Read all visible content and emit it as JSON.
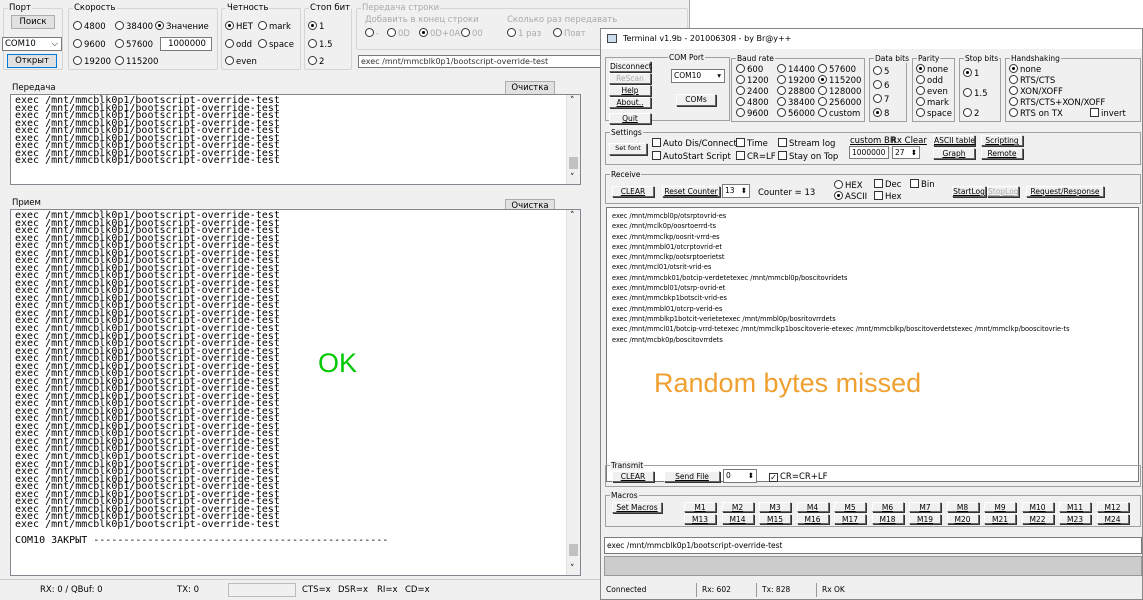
{
  "left": {
    "port": {
      "label": "Порт",
      "search": "Поиск",
      "com": "COM10",
      "open": "Открыт"
    },
    "speed": {
      "label": "Скорость",
      "opts": [
        "4800",
        "9600",
        "19200",
        "38400",
        "57600",
        "115200"
      ],
      "value_label": "Значение",
      "value": "1000000"
    },
    "parity": {
      "label": "Четность",
      "none": "НЕТ",
      "mark": "mark",
      "odd": "odd",
      "space": "space",
      "even": "even"
    },
    "stop": {
      "label": "Стоп бит",
      "o1": "1",
      "o15": "1.5",
      "o2": "2"
    },
    "line_end": {
      "label": "Передача строки",
      "add": "Добавить в конец строки",
      "opts": [
        "-",
        "0D",
        "0D+0A",
        "00"
      ],
      "repeat": "Сколько раз передавать",
      "once": "1 раз",
      "rep": "Повт"
    },
    "cmd": "exec /mnt/mmcblk0p1/bootscript-override-test",
    "tx": {
      "label": "Передача",
      "clear": "Очистка",
      "lines": [
        "exec /mnt/mmcblk0p1/bootscript-override-test",
        "exec /mnt/mmcblk0p1/bootscript-override-test",
        "exec /mnt/mmcblk0p1/bootscript-override-test",
        "exec /mnt/mmcblk0p1/bootscript-override-test",
        "exec /mnt/mmcblk0p1/bootscript-override-test",
        "exec /mnt/mmcblk0p1/bootscript-override-test",
        "exec /mnt/mmcblk0p1/bootscript-override-test",
        "exec /mnt/mmcblk0p1/bootscript-override-test",
        "exec /mnt/mmcblk0p1/bootscript-override-test"
      ]
    },
    "rx": {
      "label": "Прием",
      "clear": "Очистка",
      "line": "exec /mnt/mmcblk0p1/bootscript-override-test",
      "count": 42,
      "closed": "COM10 ЗАКРЫТ -------------------------------------------------"
    },
    "ok": "OK",
    "status": {
      "rx": "RX: 0 / QBuf: 0",
      "tx": "TX: 0",
      "cts": "CTS=x",
      "dsr": "DSR=x",
      "ri": "RI=x",
      "cd": "CD=x"
    }
  },
  "right": {
    "title": "Terminal v1.9b - 20100630Я - by Br@y++",
    "btns": {
      "disconnect": "Disconnect",
      "rescan": "ReScan",
      "help": "Help",
      "about": "About..",
      "quit": "Quit",
      "coms": "COMs"
    },
    "comport": {
      "label": "COM Port",
      "value": "COM10"
    },
    "baud": {
      "label": "Baud rate",
      "opts": [
        "600",
        "1200",
        "2400",
        "4800",
        "9600",
        "14400",
        "19200",
        "28800",
        "38400",
        "56000",
        "57600",
        "115200",
        "128000",
        "256000",
        "custom"
      ],
      "selected": "115200"
    },
    "databits": {
      "label": "Data bits",
      "opts": [
        "5",
        "6",
        "7",
        "8"
      ],
      "selected": "8"
    },
    "parity": {
      "label": "Parity",
      "opts": [
        "none",
        "odd",
        "even",
        "mark",
        "space"
      ],
      "selected": "none"
    },
    "stopbits": {
      "label": "Stop bits",
      "opts": [
        "1",
        "1.5",
        "2"
      ],
      "selected": "1"
    },
    "hs": {
      "label": "Handshaking",
      "opts": [
        "none",
        "RTS/CTS",
        "XON/XOFF",
        "RTS/CTS+XON/XOFF",
        "RTS on TX"
      ],
      "invert": "invert"
    },
    "settings": {
      "label": "Settings",
      "setfont": "Set font",
      "autodis": "Auto Dis/Connect",
      "autostart": "AutoStart Script",
      "time": "Time",
      "crlf": "CR=LF",
      "stream": "Stream log",
      "stayon": "Stay on Top",
      "custombr": "custom BR",
      "custombr_val": "1000000",
      "rxclear": "Rx Clear",
      "rxclear_val": "27",
      "ascii": "ASCII table",
      "graph": "Graph",
      "scripting": "Scripting",
      "remote": "Remote"
    },
    "receive": {
      "label": "Receive",
      "clear": "CLEAR",
      "reset": "Reset Counter",
      "count_val": "13",
      "counter": "Counter = 13",
      "hex": "HEX",
      "ascii": "ASCII",
      "dec": "Dec",
      "hex2": "Hex",
      "bin": "Bin",
      "startlog": "StartLog",
      "stoplog": "StopLog",
      "reqresp": "Request/Response"
    },
    "rxlines": [
      "exec /mnt/mmcbl0p/otsrptovrid-es",
      "exec /mnt/mclk0p/oosrtoerrd-ts",
      "exec /mnt/mmclkp/oosrit-vrrd-es",
      "exec /mnt/mmbl01/otcrptovrid-et",
      "exec /mnt/mmclkp/ootsrptoerietst",
      "exec /mnt/mcl01/otsrit-vrid-es",
      "exec /mnt/mmcbk01/botcip-verdetetexec /mnt/mmcbl0p/boscitovridets",
      "exec /mnt/mmcbl01/otsrp-ovrid-et",
      "exec /mnt/mmcbkp1botscit-vrid-es",
      "exec /mnt/mmbl01/otcrp-verid-es",
      "exec /mnt/mmblkp1botcit-verietetexec /mnt/mmbl0p/bosritovrrdets",
      "exec /mnt/mmcl01/botcip-vrrd-tetexec /mnt/mmclkp1boscitoverie-etexec /mnt/mmcblkp/boscitoverdetstexec /mnt/mmclkp/booscitovrie-ts",
      "exec /mnt/mcbk0p/boscitovrrdets"
    ],
    "missed": "Random bytes missed",
    "transmit": {
      "label": "Transmit",
      "clear": "CLEAR",
      "sendfile": "Send File",
      "val": "0",
      "crcrlf": "CR=CR+LF"
    },
    "macros": {
      "label": "Macros",
      "set": "Set Macros",
      "items": [
        "M1",
        "M2",
        "M3",
        "M4",
        "M5",
        "M6",
        "M7",
        "M8",
        "M9",
        "M10",
        "M11",
        "M12",
        "M13",
        "M14",
        "M15",
        "M16",
        "M17",
        "M18",
        "M19",
        "M20",
        "M21",
        "M22",
        "M23",
        "M24"
      ]
    },
    "cmd": "exec /mnt/mmcblk0p1/bootscript-override-test",
    "status": {
      "conn": "Connected",
      "rx": "Rx: 602",
      "tx": "Tx: 828",
      "rxok": "Rx OK"
    }
  },
  "colors": {
    "ok": "#00c800",
    "missed": "#f0a030"
  }
}
